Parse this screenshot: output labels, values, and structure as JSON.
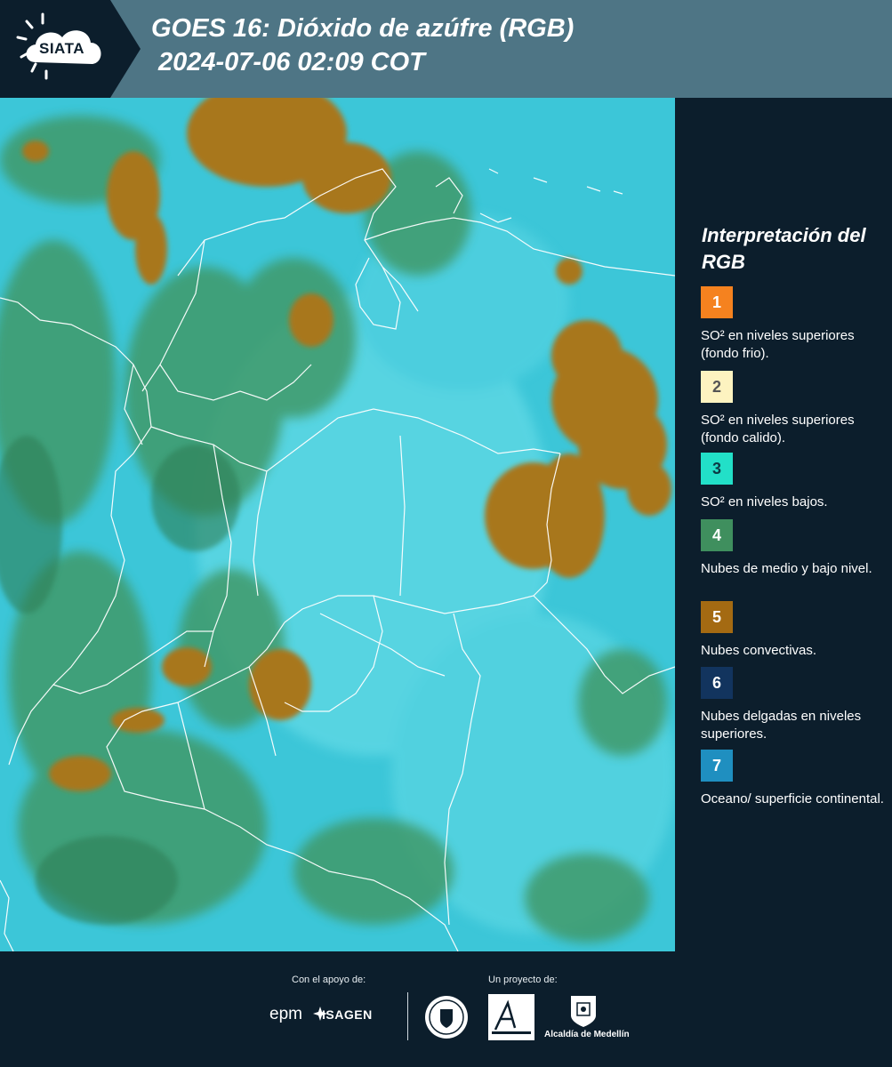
{
  "header": {
    "logo_text": "SIATA",
    "title": "GOES 16: Dióxido de azúfre (RGB)",
    "subtitle": "2024-07-06 02:09 COT"
  },
  "legend": {
    "title": "Interpretación del RGB",
    "items": [
      {
        "number": "1",
        "color": "#f5821f",
        "number_color": "#ffffff",
        "text": "SO² en niveles superiores (fondo frio)."
      },
      {
        "number": "2",
        "color": "#fdf3c0",
        "number_color": "#555555",
        "text": "SO² en niveles superiores (fondo calido)."
      },
      {
        "number": "3",
        "color": "#22e0c8",
        "number_color": "#0c3a44",
        "text": "SO² en niveles bajos."
      },
      {
        "number": "4",
        "color": "#3f8f5e",
        "number_color": "#ffffff",
        "text": "Nubes de medio y bajo nivel."
      },
      {
        "number": "5",
        "color": "#a46a12",
        "number_color": "#ffffff",
        "text": "Nubes convectivas."
      },
      {
        "number": "6",
        "color": "#12345e",
        "number_color": "#ffffff",
        "text": "Nubes delgadas en niveles superiores."
      },
      {
        "number": "7",
        "color": "#1f8fc0",
        "number_color": "#ffffff",
        "text": "Oceano/ superficie continental."
      }
    ]
  },
  "footer": {
    "support_label": "Con el apoyo de:",
    "project_label": "Un proyecto de:",
    "epm_logo": "epm",
    "isagen_logo": "ISAGEN",
    "alcaldia_label": "Alcaldía de Medellín"
  },
  "map": {
    "ocean_color": "#3cc6d8",
    "mid_low_cloud_color": "#3f9a6a",
    "convective_color": "#a8771f",
    "boundary_color": "#ffffff"
  }
}
